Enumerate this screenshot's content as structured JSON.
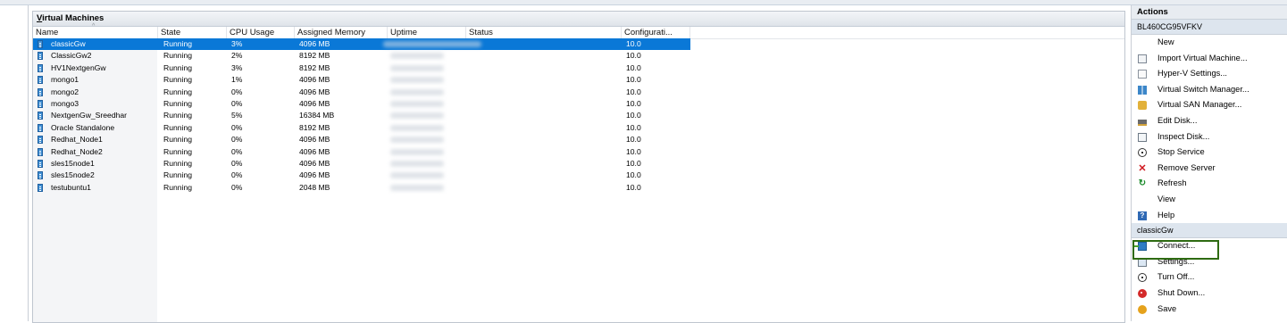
{
  "vm_panel": {
    "title_prefix": "V",
    "title_rest": "irtual Machines",
    "columns": [
      "Name",
      "State",
      "CPU Usage",
      "Assigned Memory",
      "Uptime",
      "Status",
      "Configurati..."
    ],
    "rows": [
      {
        "name": "classicGw",
        "state": "Running",
        "cpu": "3%",
        "memory": "4096 MB",
        "config": "10.0",
        "selected": true
      },
      {
        "name": "ClassicGw2",
        "state": "Running",
        "cpu": "2%",
        "memory": "8192 MB",
        "config": "10.0"
      },
      {
        "name": "HV1NextgenGw",
        "state": "Running",
        "cpu": "3%",
        "memory": "8192 MB",
        "config": "10.0"
      },
      {
        "name": "mongo1",
        "state": "Running",
        "cpu": "1%",
        "memory": "4096 MB",
        "config": "10.0"
      },
      {
        "name": "mongo2",
        "state": "Running",
        "cpu": "0%",
        "memory": "4096 MB",
        "config": "10.0"
      },
      {
        "name": "mongo3",
        "state": "Running",
        "cpu": "0%",
        "memory": "4096 MB",
        "config": "10.0"
      },
      {
        "name": "NextgenGw_Sreedhar",
        "state": "Running",
        "cpu": "5%",
        "memory": "16384 MB",
        "config": "10.0"
      },
      {
        "name": "Oracle Standalone",
        "state": "Running",
        "cpu": "0%",
        "memory": "8192 MB",
        "config": "10.0"
      },
      {
        "name": "Redhat_Node1",
        "state": "Running",
        "cpu": "0%",
        "memory": "4096 MB",
        "config": "10.0"
      },
      {
        "name": "Redhat_Node2",
        "state": "Running",
        "cpu": "0%",
        "memory": "4096 MB",
        "config": "10.0"
      },
      {
        "name": "sles15node1",
        "state": "Running",
        "cpu": "0%",
        "memory": "4096 MB",
        "config": "10.0"
      },
      {
        "name": "sles15node2",
        "state": "Running",
        "cpu": "0%",
        "memory": "4096 MB",
        "config": "10.0"
      },
      {
        "name": "testubuntu1",
        "state": "Running",
        "cpu": "0%",
        "memory": "2048 MB",
        "config": "10.0"
      }
    ]
  },
  "actions": {
    "header": "Actions",
    "host_section": "BL460CG95VFKV",
    "host_items": [
      {
        "label": "New",
        "icon": "none"
      },
      {
        "label": "Import Virtual Machine...",
        "icon": "import-icon"
      },
      {
        "label": "Hyper-V Settings...",
        "icon": "hyperv-settings-icon"
      },
      {
        "label": "Virtual Switch Manager...",
        "icon": "switch-manager-icon"
      },
      {
        "label": "Virtual SAN Manager...",
        "icon": "san-manager-icon"
      },
      {
        "label": "Edit Disk...",
        "icon": "edit-disk-icon"
      },
      {
        "label": "Inspect Disk...",
        "icon": "inspect-disk-icon"
      },
      {
        "label": "Stop Service",
        "icon": "stop-icon"
      },
      {
        "label": "Remove Server",
        "icon": "remove-icon"
      },
      {
        "label": "Refresh",
        "icon": "refresh-icon"
      },
      {
        "label": "View",
        "icon": "none"
      },
      {
        "label": "Help",
        "icon": "help-icon"
      }
    ],
    "vm_section": "classicGw",
    "vm_items": [
      {
        "label": "Connect...",
        "icon": "connect-icon"
      },
      {
        "label": "Settings...",
        "icon": "settings-icon"
      },
      {
        "label": "Turn Off...",
        "icon": "turn-off-icon"
      },
      {
        "label": "Shut Down...",
        "icon": "shut-down-icon"
      },
      {
        "label": "Save",
        "icon": "save-icon"
      }
    ],
    "highlight_color": "#2e6b12"
  },
  "colors": {
    "selection": "#0a78d7",
    "vm_icon": "#3f8fd4"
  }
}
